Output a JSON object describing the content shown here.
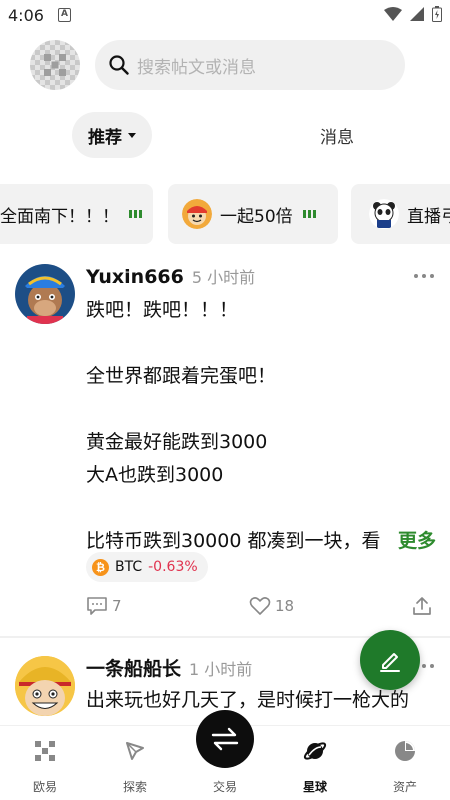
{
  "status_bar": {
    "time": "4:06",
    "notif_letter": "A"
  },
  "search": {
    "placeholder": "搜索帖文或消息"
  },
  "tabs": {
    "recommended": "推荐",
    "messages": "消息"
  },
  "topics": [
    {
      "label": "全面南下！！！"
    },
    {
      "label": "一起50倍"
    },
    {
      "label": "直播弓"
    }
  ],
  "posts": [
    {
      "author": "Yuxin666",
      "time": "5 小时前",
      "lines": [
        "跌吧！跌吧！！！",
        "",
        "全世界都跟着完蛋吧！",
        "",
        "黄金最好能跌到3000",
        "大A也跌到3000",
        "",
        "比特币跌到30000  都凑到一块，看"
      ],
      "more": "更多",
      "tag": {
        "symbol": "BTC",
        "change": "-0.63%"
      },
      "comments": "7",
      "likes": "18"
    },
    {
      "author": "一条船船长",
      "time": "1 小时前",
      "lines": [
        "出来玩也好几天了，是时候打一枪大的"
      ]
    }
  ],
  "bottom_nav": [
    {
      "label": "欧易",
      "icon": "okx-logo-icon"
    },
    {
      "label": "探索",
      "icon": "compass-icon"
    },
    {
      "label": "交易",
      "icon": "swap-arrows-icon"
    },
    {
      "label": "星球",
      "icon": "planet-icon"
    },
    {
      "label": "资产",
      "icon": "pie-chart-icon"
    }
  ],
  "colors": {
    "accent_green": "#1f7a2a",
    "negative_red": "#e0334f",
    "btc_orange": "#f7931a"
  }
}
